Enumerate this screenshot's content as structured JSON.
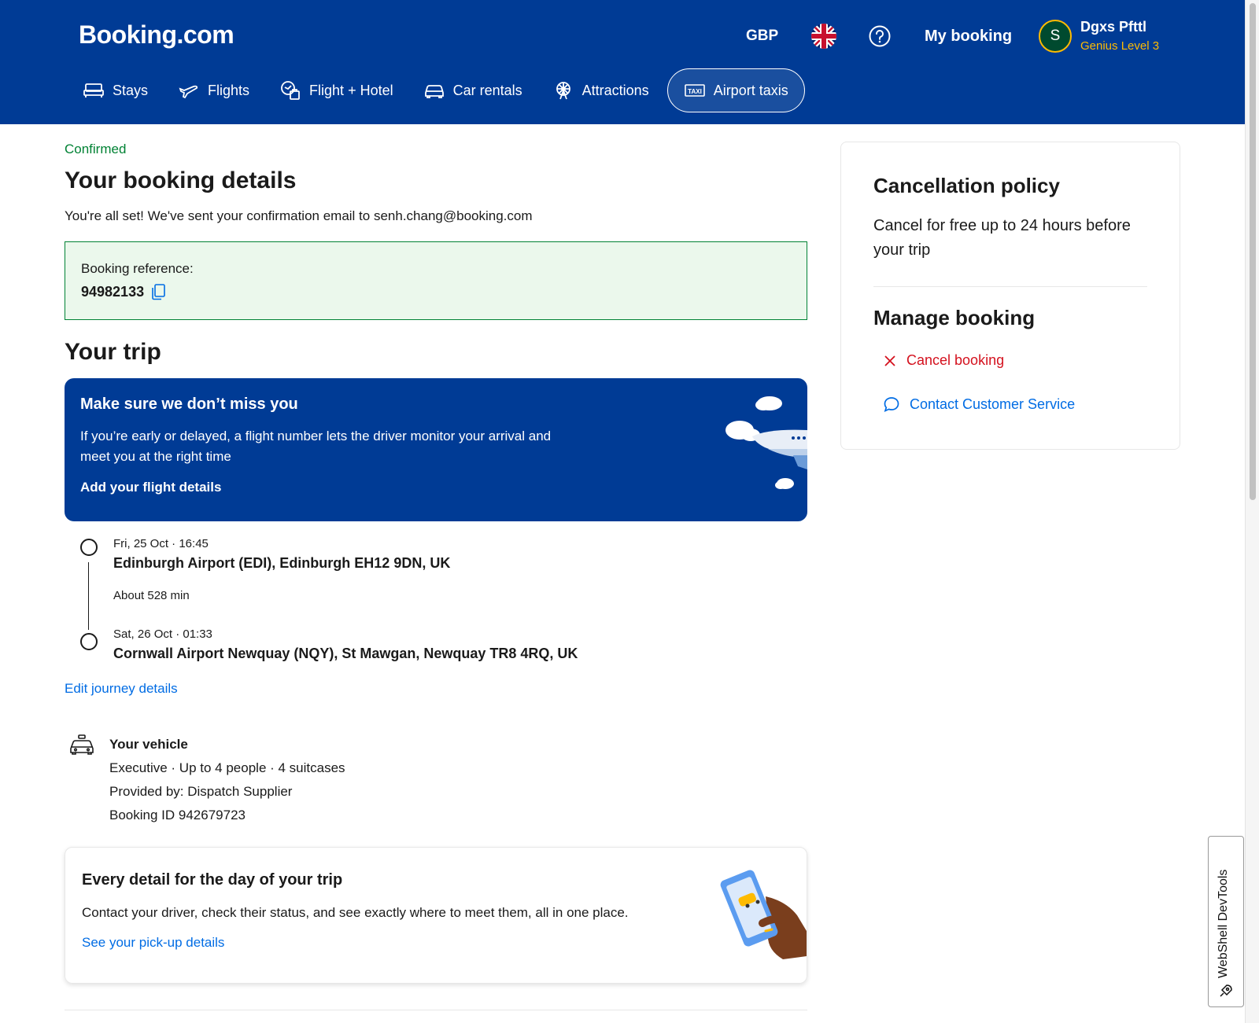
{
  "header": {
    "logo": "Booking.com",
    "currency": "GBP",
    "my_booking": "My booking",
    "user": {
      "initial": "S",
      "name": "Dgxs Pfttl",
      "level": "Genius Level 3"
    }
  },
  "nav": [
    {
      "label": "Stays",
      "icon": "bed-icon"
    },
    {
      "label": "Flights",
      "icon": "plane-icon"
    },
    {
      "label": "Flight + Hotel",
      "icon": "flight-hotel-icon"
    },
    {
      "label": "Car rentals",
      "icon": "car-icon"
    },
    {
      "label": "Attractions",
      "icon": "attractions-icon"
    },
    {
      "label": "Airport taxis",
      "icon": "taxi-icon",
      "active": true
    }
  ],
  "main": {
    "status": "Confirmed",
    "title": "Your booking details",
    "subtitle": "You're all set! We've sent your confirmation email to senh.chang@booking.com",
    "reference_label": "Booking reference:",
    "reference_number": "94982133",
    "trip_title": "Your trip",
    "banner": {
      "title": "Make sure we don’t miss you",
      "text": "If you’re early or delayed, a flight number lets the driver monitor your arrival and meet you at the right time",
      "link": "Add your flight details"
    },
    "journey": {
      "pickup": {
        "time": "Fri, 25 Oct · 16:45",
        "place": "Edinburgh Airport (EDI), Edinburgh EH12 9DN, UK"
      },
      "duration": "About 528 min",
      "dropoff": {
        "time": "Sat, 26 Oct · 01:33",
        "place": "Cornwall Airport Newquay (NQY), St Mawgan, Newquay TR8 4RQ, UK"
      },
      "edit_link": "Edit journey details"
    },
    "vehicle": {
      "title": "Your vehicle",
      "details": "Executive · Up to 4 people · 4 suitcases",
      "provider": "Provided by: Dispatch Supplier",
      "booking_id": "Booking ID 942679723"
    },
    "trip_card": {
      "title": "Every detail for the day of your trip",
      "text": "Contact your driver, check their status, and see exactly where to meet them, all in one place.",
      "link": "See your pick-up details"
    }
  },
  "sidebar": {
    "cancellation_title": "Cancellation policy",
    "cancellation_text": "Cancel for free up to 24 hours before your trip",
    "manage_title": "Manage booking",
    "cancel_link": "Cancel booking",
    "contact_link": "Contact Customer Service"
  },
  "devtools": {
    "label": "WebShell DevTools"
  },
  "colors": {
    "brand": "#003b95",
    "confirmed": "#008234",
    "link": "#006ce4",
    "danger": "#d4111e",
    "genius": "#febb02"
  }
}
